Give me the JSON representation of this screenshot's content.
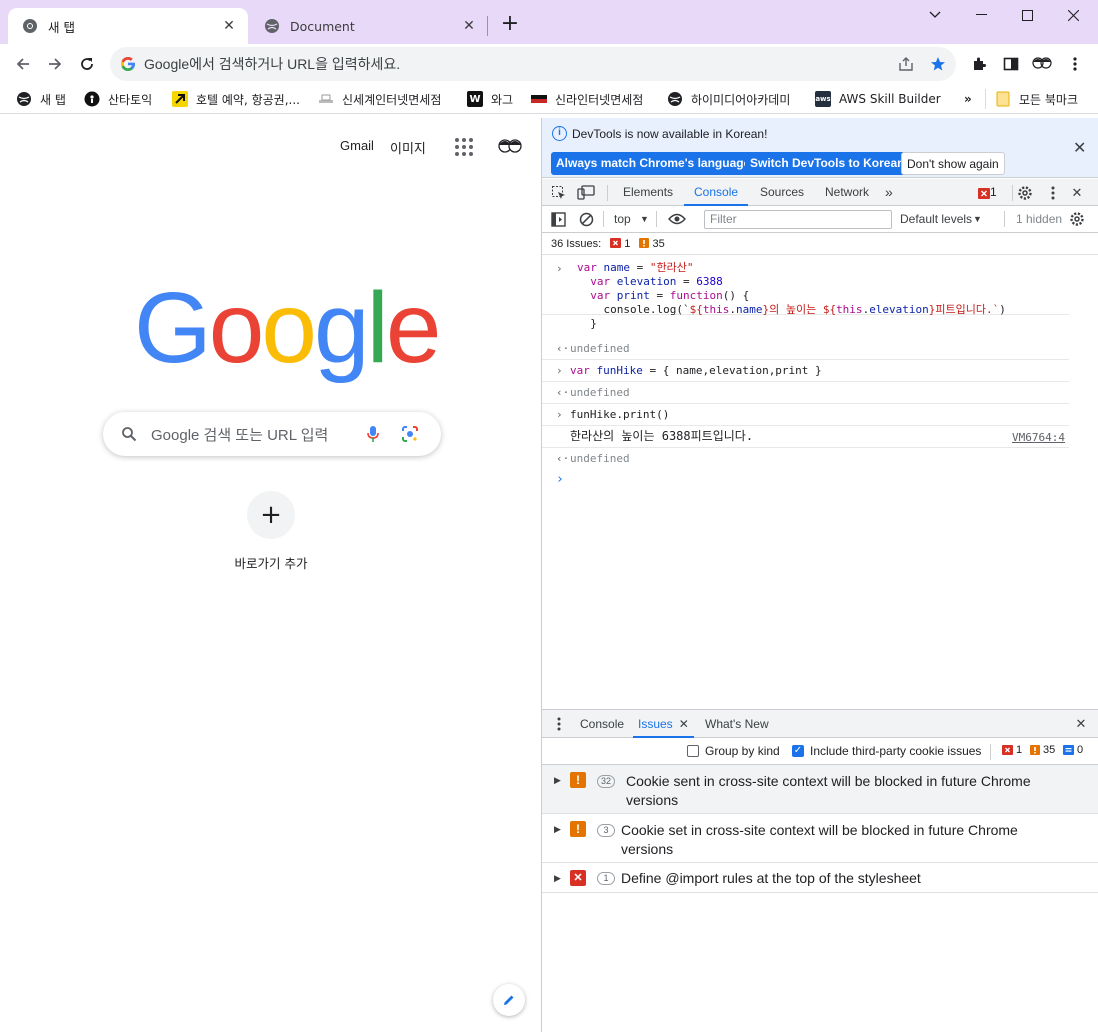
{
  "browser": {
    "tabs": [
      {
        "title": "새 탭",
        "active": true
      },
      {
        "title": "Document",
        "active": false
      }
    ],
    "omnibox_text": "Google에서 검색하거나 URL을 입력하세요.",
    "bookmarks": [
      {
        "label": "새 탭",
        "icon": "globe-icon"
      },
      {
        "label": "산타토익",
        "icon": "santa-icon"
      },
      {
        "label": "호텔 예약, 항공권,...",
        "icon": "arrow-icon"
      },
      {
        "label": "신세계인터넷면세점",
        "icon": "shinsegae-icon"
      },
      {
        "label": "와그",
        "icon": "w-icon"
      },
      {
        "label": "신라인터넷면세점",
        "icon": "shilla-icon"
      },
      {
        "label": "하이미디어아카데미",
        "icon": "globe-icon"
      },
      {
        "label": "AWS Skill Builder",
        "icon": "aws-icon"
      }
    ],
    "bookmarks_more": "»",
    "all_bookmarks": "모든 북마크"
  },
  "ntp": {
    "gmail": "Gmail",
    "images": "이미지",
    "search_placeholder": "Google 검색 또는 URL 입력",
    "shortcut_label": "바로가기 추가",
    "logo_letters": [
      "G",
      "o",
      "o",
      "g",
      "l",
      "e"
    ],
    "logo_colors": [
      "#4285f4",
      "#ea4335",
      "#fbbc05",
      "#4285f4",
      "#34a853",
      "#ea4335"
    ]
  },
  "devtools": {
    "infobar": {
      "message": "DevTools is now available in Korean!",
      "btn_match": "Always match Chrome's language",
      "btn_switch": "Switch DevTools to Korean",
      "btn_dont": "Don't show again"
    },
    "tabs": [
      "Elements",
      "Console",
      "Sources",
      "Network"
    ],
    "active_tab": "Console",
    "error_count": "1",
    "console_toolbar": {
      "context": "top",
      "filter_placeholder": "Filter",
      "levels": "Default levels",
      "hidden": "1 hidden"
    },
    "issues_summary": {
      "label": "36 Issues:",
      "errors": "1",
      "warnings": "35"
    },
    "console": {
      "line1": [
        "var name = \"한라산\"",
        "var elevation = 6388",
        "var print = function() {",
        "  console.log(`${this.name}의 높이는 ${this.elevation}피트입니다.`)",
        "}"
      ],
      "undefined": "undefined",
      "line2": "var funHike = { name,elevation,print }",
      "line3": "funHike.print()",
      "output": "한라산의 높이는 6388피트입니다.",
      "source": "VM6764:4"
    },
    "drawer": {
      "tabs": [
        "Console",
        "Issues",
        "What's New"
      ],
      "active_tab": "Issues",
      "group_by_kind": "Group by kind",
      "include_third_party": "Include third-party cookie issues",
      "counts": {
        "errors": "1",
        "warnings": "35",
        "info": "0"
      },
      "issues": [
        {
          "kind": "warning",
          "count": "32",
          "title_line1": "Cookie sent in cross-site context will be blocked in future Chrome",
          "title_line2": "versions"
        },
        {
          "kind": "warning",
          "count": "3",
          "title_line1": "Cookie set in cross-site context will be blocked in future Chrome",
          "title_line2": "versions"
        },
        {
          "kind": "error",
          "count": "1",
          "title_line1": "Define @import rules at the top of the stylesheet",
          "title_line2": ""
        }
      ]
    }
  },
  "colors": {
    "tab_strip": "#e8d9f9",
    "accent": "#1a73e8",
    "warning": "#e37400",
    "error": "#d93025"
  }
}
